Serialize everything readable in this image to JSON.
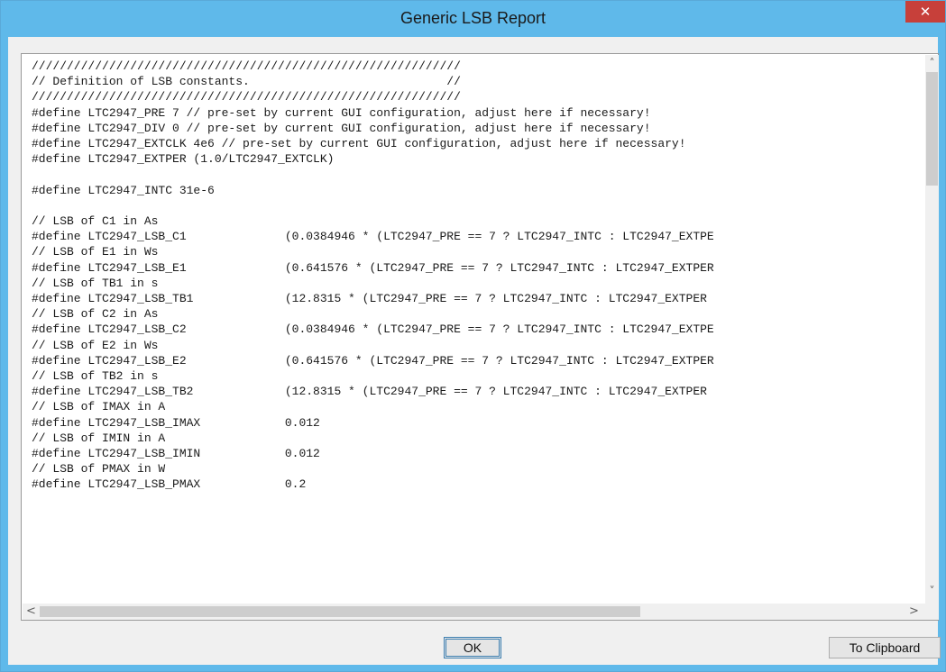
{
  "window": {
    "title": "Generic LSB Report",
    "close_glyph": "✕"
  },
  "report": {
    "text": "/////////////////////////////////////////////////////////////\n// Definition of LSB constants.                            //\n/////////////////////////////////////////////////////////////\n#define LTC2947_PRE 7 // pre-set by current GUI configuration, adjust here if necessary!\n#define LTC2947_DIV 0 // pre-set by current GUI configuration, adjust here if necessary!\n#define LTC2947_EXTCLK 4e6 // pre-set by current GUI configuration, adjust here if necessary!\n#define LTC2947_EXTPER (1.0/LTC2947_EXTCLK)\n\n#define LTC2947_INTC 31e-6\n\n// LSB of C1 in As\n#define LTC2947_LSB_C1              (0.0384946 * (LTC2947_PRE == 7 ? LTC2947_INTC : LTC2947_EXTPE\n// LSB of E1 in Ws\n#define LTC2947_LSB_E1              (0.641576 * (LTC2947_PRE == 7 ? LTC2947_INTC : LTC2947_EXTPER\n// LSB of TB1 in s\n#define LTC2947_LSB_TB1             (12.8315 * (LTC2947_PRE == 7 ? LTC2947_INTC : LTC2947_EXTPER\n// LSB of C2 in As\n#define LTC2947_LSB_C2              (0.0384946 * (LTC2947_PRE == 7 ? LTC2947_INTC : LTC2947_EXTPE\n// LSB of E2 in Ws\n#define LTC2947_LSB_E2              (0.641576 * (LTC2947_PRE == 7 ? LTC2947_INTC : LTC2947_EXTPER\n// LSB of TB2 in s\n#define LTC2947_LSB_TB2             (12.8315 * (LTC2947_PRE == 7 ? LTC2947_INTC : LTC2947_EXTPER\n// LSB of IMAX in A\n#define LTC2947_LSB_IMAX            0.012\n// LSB of IMIN in A\n#define LTC2947_LSB_IMIN            0.012\n// LSB of PMAX in W\n#define LTC2947_LSB_PMAX            0.2"
  },
  "scrollbars": {
    "up_glyph": "˄",
    "down_glyph": "˅",
    "left_glyph": "<",
    "right_glyph": ">"
  },
  "buttons": {
    "ok_label": "OK",
    "clipboard_label": "To Clipboard"
  }
}
